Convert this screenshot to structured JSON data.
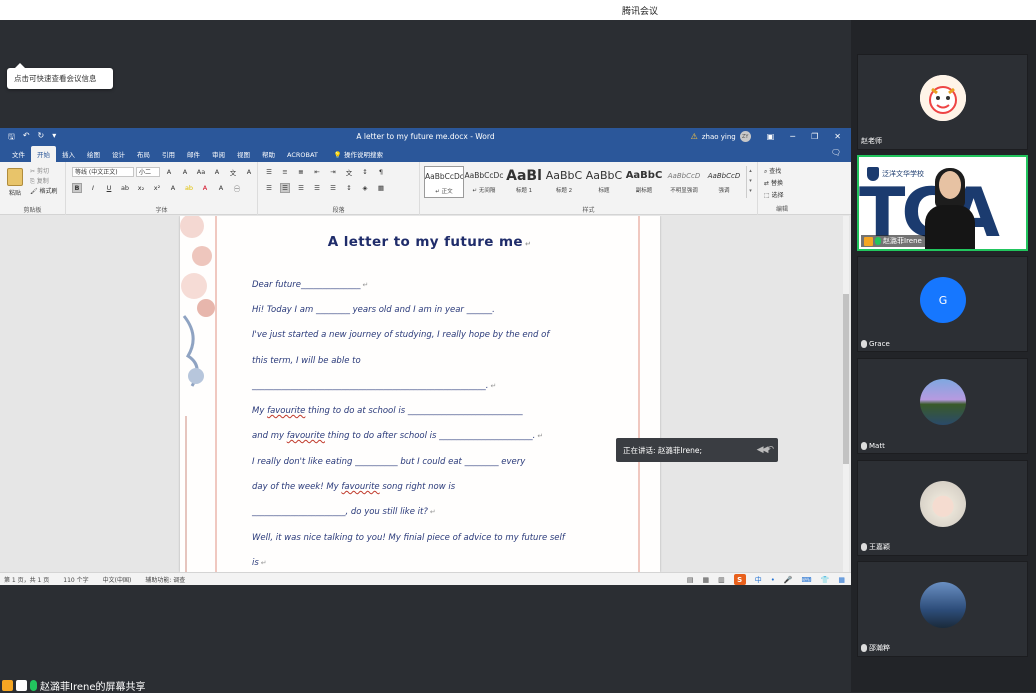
{
  "app": {
    "title": "腾讯会议"
  },
  "info_tip": "点击可快速查看会议信息",
  "word": {
    "doc_title": "A letter to my future me.docx - Word",
    "user": "zhao ying",
    "user_initials": "ZY",
    "menu_tabs": [
      "文件",
      "开始",
      "插入",
      "绘图",
      "设计",
      "布局",
      "引用",
      "邮件",
      "审阅",
      "视图",
      "帮助",
      "ACROBAT"
    ],
    "active_tab": "开始",
    "tell_me": "操作说明搜索",
    "clipboard": {
      "paste": "粘贴",
      "cut": "剪切",
      "copy": "复制",
      "format_painter": "格式刷",
      "label": "剪贴板"
    },
    "font": {
      "name": "等线 (中文正文)",
      "size": "小二",
      "label": "字体"
    },
    "paragraph_label": "段落",
    "styles": {
      "label": "样式",
      "items": [
        {
          "sample": "AaBbCcDc",
          "name": "↵ 正文"
        },
        {
          "sample": "AaBbCcDc",
          "name": "↵ 无间隔"
        },
        {
          "sample": "AaBl",
          "name": "标题 1"
        },
        {
          "sample": "AaBbC",
          "name": "标题 2"
        },
        {
          "sample": "AaBbC",
          "name": "标题"
        },
        {
          "sample": "AaBbC",
          "name": "副标题"
        },
        {
          "sample": "AaBbCcD",
          "name": "不明显强调"
        },
        {
          "sample": "AaBbCcD",
          "name": "强调"
        }
      ]
    },
    "editing": {
      "find": "查找",
      "replace": "替换",
      "select": "选择",
      "label": "编辑"
    },
    "status": {
      "page": "第 1 页，共 1 页",
      "words": "110 个字",
      "lang": "中文(中国)",
      "accessibility": "辅助功能: 调查"
    }
  },
  "document": {
    "title": "A letter to my future me",
    "lines": [
      "Dear future______________",
      "Hi! Today I am ________ years old and I am in year ______.",
      "I've just started a new journey of studying, I really hope by the end of",
      "this term, I will be able to",
      "_______________________________________________________.",
      "My favourite thing to do at school is ___________________________",
      "and my favourite thing to do after school is ______________________.",
      "I really don't like eating __________ but I could eat ________ every",
      "day of the week! My favourite song right now is",
      "______________________, do you still like it?",
      "Well, it was nice talking to you! My finial piece of advice to my future self",
      "is"
    ]
  },
  "speaking": "正在讲话: 赵潞菲Irene;",
  "participants": [
    {
      "name": "赵老师",
      "avatar_color": "#ffffff",
      "avatar_initial": "",
      "mic": "muted",
      "active": false
    },
    {
      "name": "赵潞菲Irene",
      "school": "泛洋文华学校",
      "banner": "TCA",
      "mic": "on",
      "active": true
    },
    {
      "name": "Grace",
      "avatar_color": "#1677ff",
      "avatar_initial": "G",
      "mic": "muted",
      "active": false
    },
    {
      "name": "Matt",
      "avatar_color": "#3a6aa8",
      "avatar_initial": "",
      "mic": "muted",
      "active": false
    },
    {
      "name": "王嘉颖",
      "avatar_color": "#d9d2c6",
      "avatar_initial": "",
      "mic": "muted",
      "active": false
    },
    {
      "name": "邵瀚粹",
      "avatar_color": "#4b6e9c",
      "avatar_initial": "",
      "mic": "muted",
      "active": false
    }
  ],
  "share_label": "赵潞菲Irene的屏幕共享"
}
